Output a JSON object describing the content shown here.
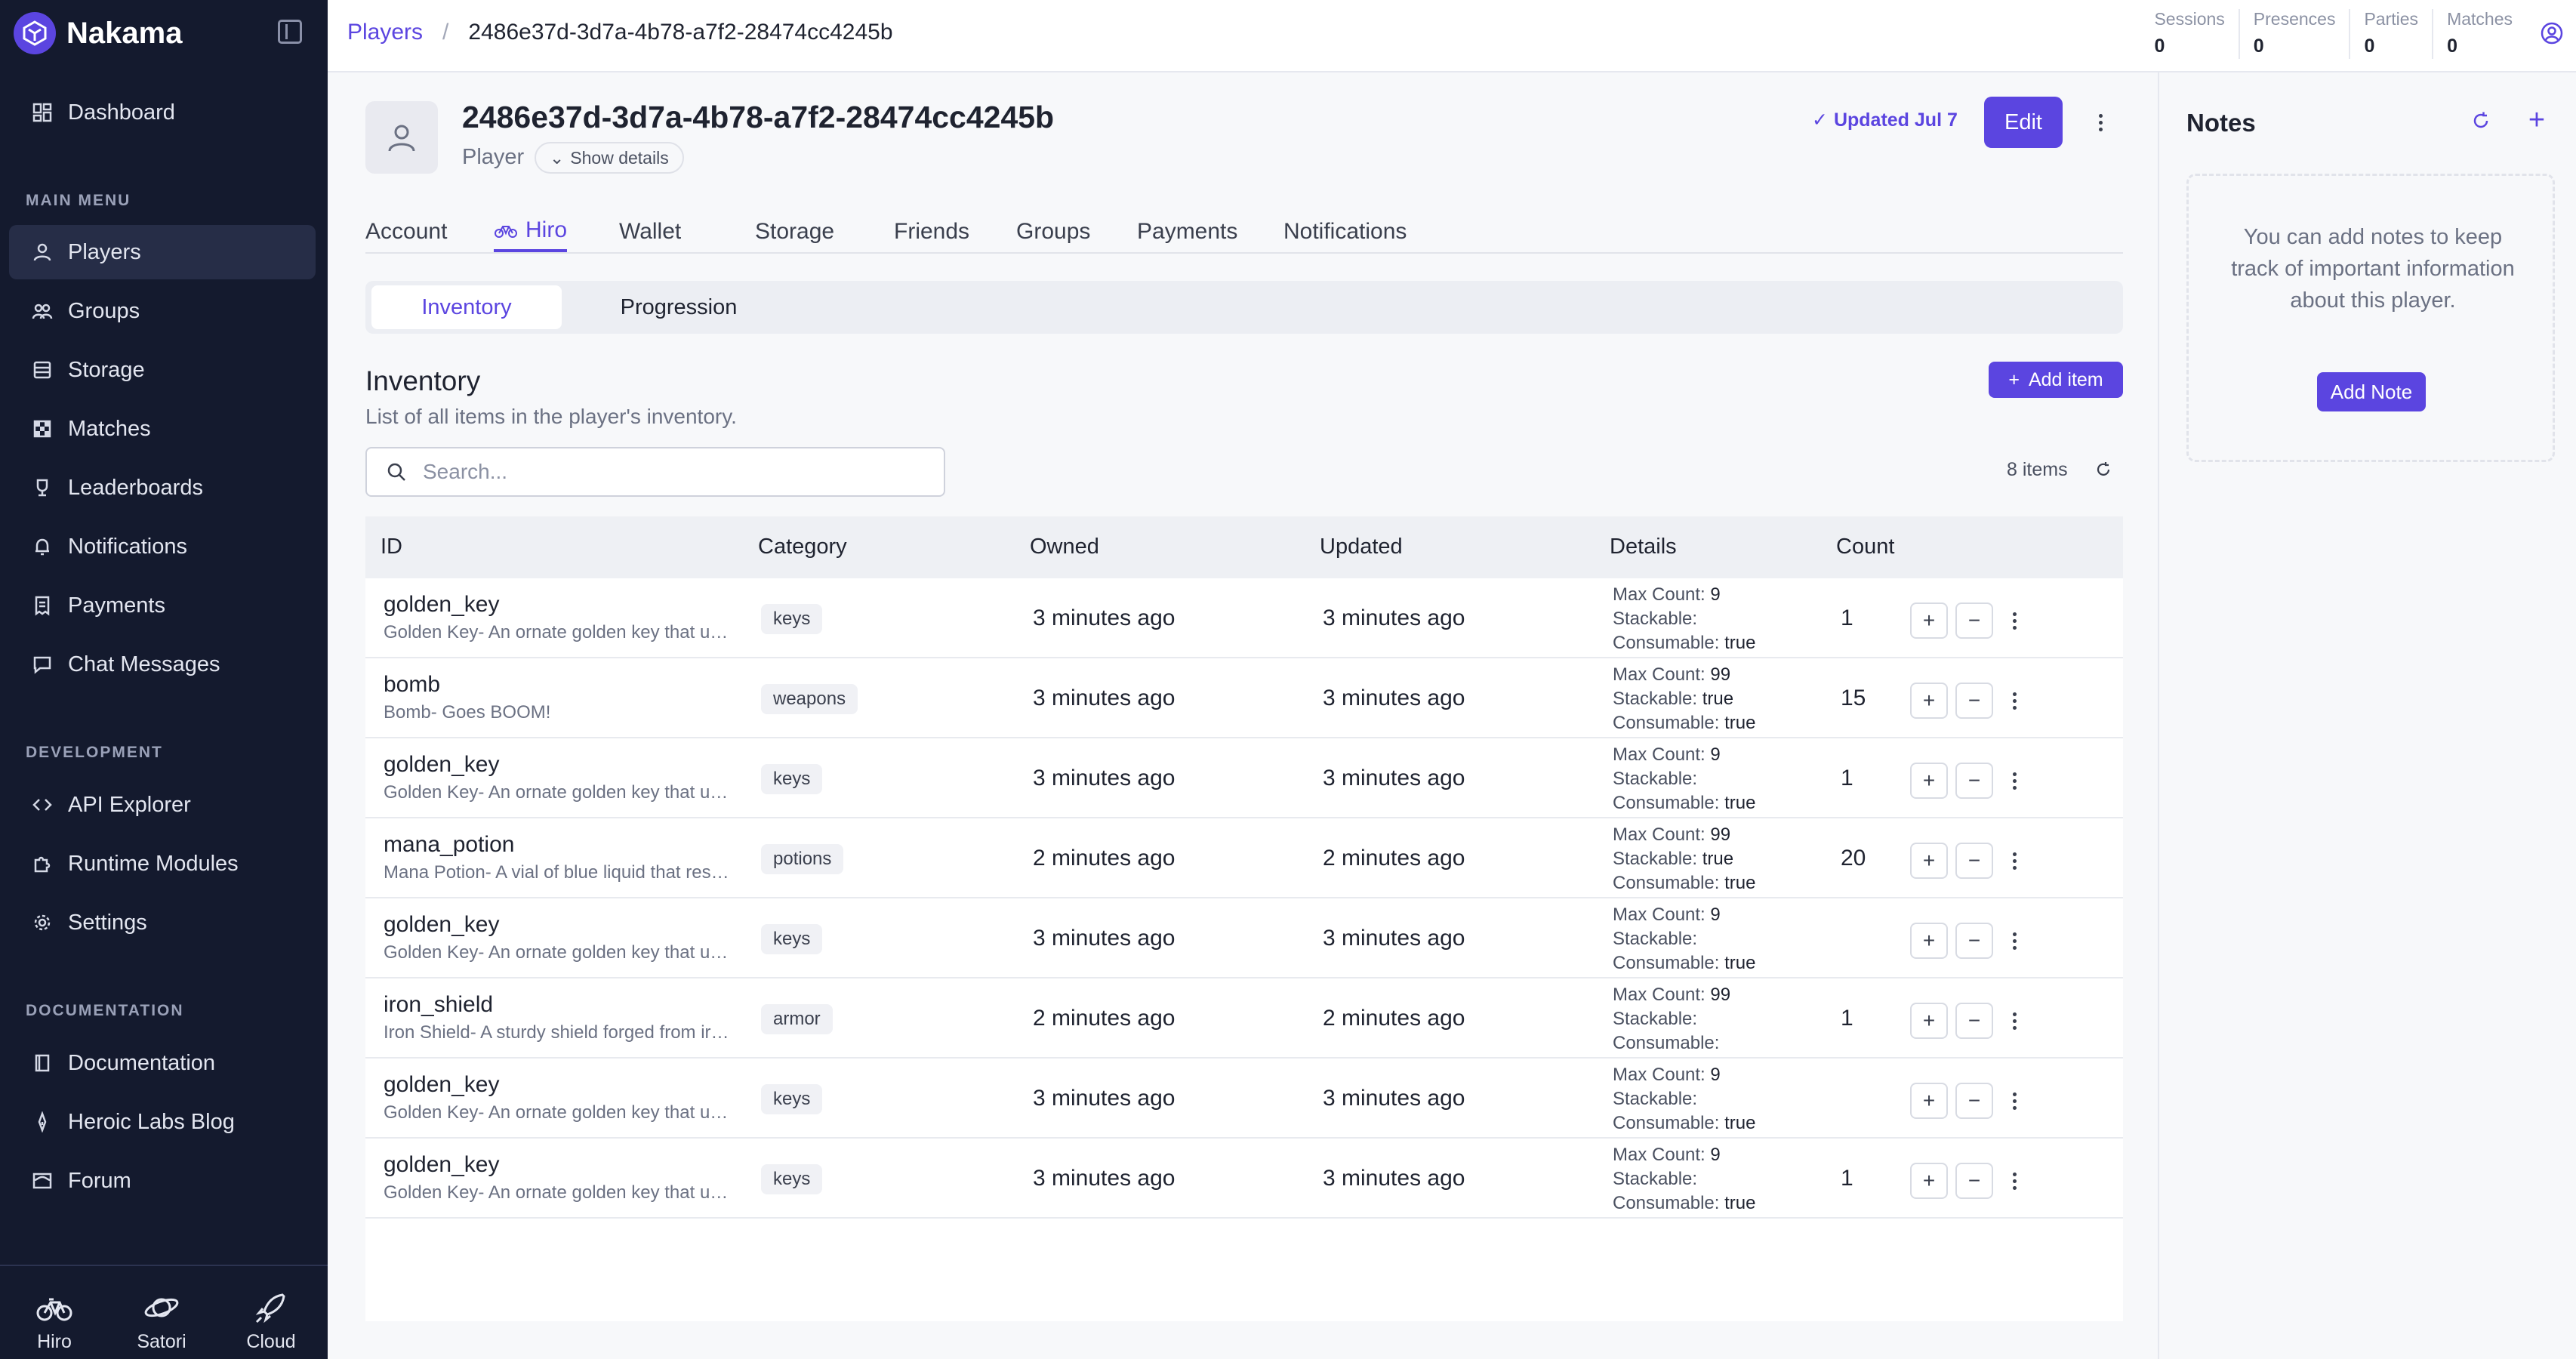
{
  "app": {
    "name": "Nakama"
  },
  "sidebar": {
    "dashboard": "Dashboard",
    "main_menu_label": "MAIN MENU",
    "main_menu": [
      {
        "label": "Players",
        "icon": "user-icon",
        "active": true
      },
      {
        "label": "Groups",
        "icon": "groups-icon"
      },
      {
        "label": "Storage",
        "icon": "storage-icon"
      },
      {
        "label": "Matches",
        "icon": "matches-icon"
      },
      {
        "label": "Leaderboards",
        "icon": "trophy-icon"
      },
      {
        "label": "Notifications",
        "icon": "bell-icon"
      },
      {
        "label": "Payments",
        "icon": "receipt-icon"
      },
      {
        "label": "Chat Messages",
        "icon": "chat-icon"
      }
    ],
    "development_label": "DEVELOPMENT",
    "development": [
      {
        "label": "API Explorer",
        "icon": "code-icon"
      },
      {
        "label": "Runtime Modules",
        "icon": "puzzle-icon"
      },
      {
        "label": "Settings",
        "icon": "gear-icon"
      }
    ],
    "documentation_label": "DOCUMENTATION",
    "documentation": [
      {
        "label": "Documentation",
        "icon": "book-icon"
      },
      {
        "label": "Heroic Labs Blog",
        "icon": "blog-icon"
      },
      {
        "label": "Forum",
        "icon": "forum-icon"
      }
    ],
    "bottom": [
      {
        "label": "Hiro",
        "icon": "bicycle-icon"
      },
      {
        "label": "Satori",
        "icon": "planet-icon"
      },
      {
        "label": "Cloud",
        "icon": "rocket-icon"
      }
    ]
  },
  "topbar": {
    "breadcrumb": [
      "Players",
      "2486e37d-3d7a-4b78-a7f2-28474cc4245b"
    ],
    "stats": [
      {
        "label": "Sessions",
        "value": "0"
      },
      {
        "label": "Presences",
        "value": "0"
      },
      {
        "label": "Parties",
        "value": "0"
      },
      {
        "label": "Matches",
        "value": "0"
      }
    ]
  },
  "player": {
    "id": "2486e37d-3d7a-4b78-a7f2-28474cc4245b",
    "role": "Player",
    "show_details": "Show details",
    "updated": "Updated Jul 7",
    "edit": "Edit"
  },
  "tabs": [
    "Account",
    "Hiro",
    "Wallet",
    "Storage",
    "Friends",
    "Groups",
    "Payments",
    "Notifications"
  ],
  "subtabs": [
    "Inventory",
    "Progression"
  ],
  "inventory": {
    "title": "Inventory",
    "subtitle": "List of all items in the player's inventory.",
    "add_item": "Add item",
    "search_placeholder": "Search...",
    "count_label": "8 items",
    "columns": [
      "ID",
      "Category",
      "Owned",
      "Updated",
      "Details",
      "Count"
    ],
    "details_labels": {
      "max": "Max Count:",
      "stack": "Stackable:",
      "cons": "Consumable:"
    },
    "rows": [
      {
        "id": "golden_key",
        "desc": "Golden Key- An ornate golden key that unlocks a treasure chest",
        "category": "keys",
        "owned": "3 minutes ago",
        "updated": "3 minutes ago",
        "max": "9",
        "stack": "",
        "cons": "true",
        "count": "1"
      },
      {
        "id": "bomb",
        "desc": "Bomb- Goes BOOM!",
        "category": "weapons",
        "owned": "3 minutes ago",
        "updated": "3 minutes ago",
        "max": "99",
        "stack": "true",
        "cons": "true",
        "count": "15"
      },
      {
        "id": "golden_key",
        "desc": "Golden Key- An ornate golden key that unlocks a treasure chest",
        "category": "keys",
        "owned": "3 minutes ago",
        "updated": "3 minutes ago",
        "max": "9",
        "stack": "",
        "cons": "true",
        "count": "1"
      },
      {
        "id": "mana_potion",
        "desc": "Mana Potion- A vial of blue liquid that restores mana",
        "category": "potions",
        "owned": "2 minutes ago",
        "updated": "2 minutes ago",
        "max": "99",
        "stack": "true",
        "cons": "true",
        "count": "20"
      },
      {
        "id": "golden_key",
        "desc": "Golden Key- An ornate golden key that unlocks a treasure chest",
        "category": "keys",
        "owned": "3 minutes ago",
        "updated": "3 minutes ago",
        "max": "9",
        "stack": "",
        "cons": "true",
        "count": ""
      },
      {
        "id": "iron_shield",
        "desc": "Iron Shield- A sturdy shield forged from iron",
        "category": "armor",
        "owned": "2 minutes ago",
        "updated": "2 minutes ago",
        "max": "99",
        "stack": "",
        "cons": "",
        "count": "1"
      },
      {
        "id": "golden_key",
        "desc": "Golden Key- An ornate golden key that unlocks a treasure chest",
        "category": "keys",
        "owned": "3 minutes ago",
        "updated": "3 minutes ago",
        "max": "9",
        "stack": "",
        "cons": "true",
        "count": ""
      },
      {
        "id": "golden_key",
        "desc": "Golden Key- An ornate golden key that unlocks a treasure chest",
        "category": "keys",
        "owned": "3 minutes ago",
        "updated": "3 minutes ago",
        "max": "9",
        "stack": "",
        "cons": "true",
        "count": "1"
      }
    ]
  },
  "notes": {
    "title": "Notes",
    "empty": "You can add notes to keep track of important information about this player.",
    "add_note": "Add Note"
  },
  "colors": {
    "accent": "#5b45e0",
    "sidebar_bg": "#141a2e"
  }
}
